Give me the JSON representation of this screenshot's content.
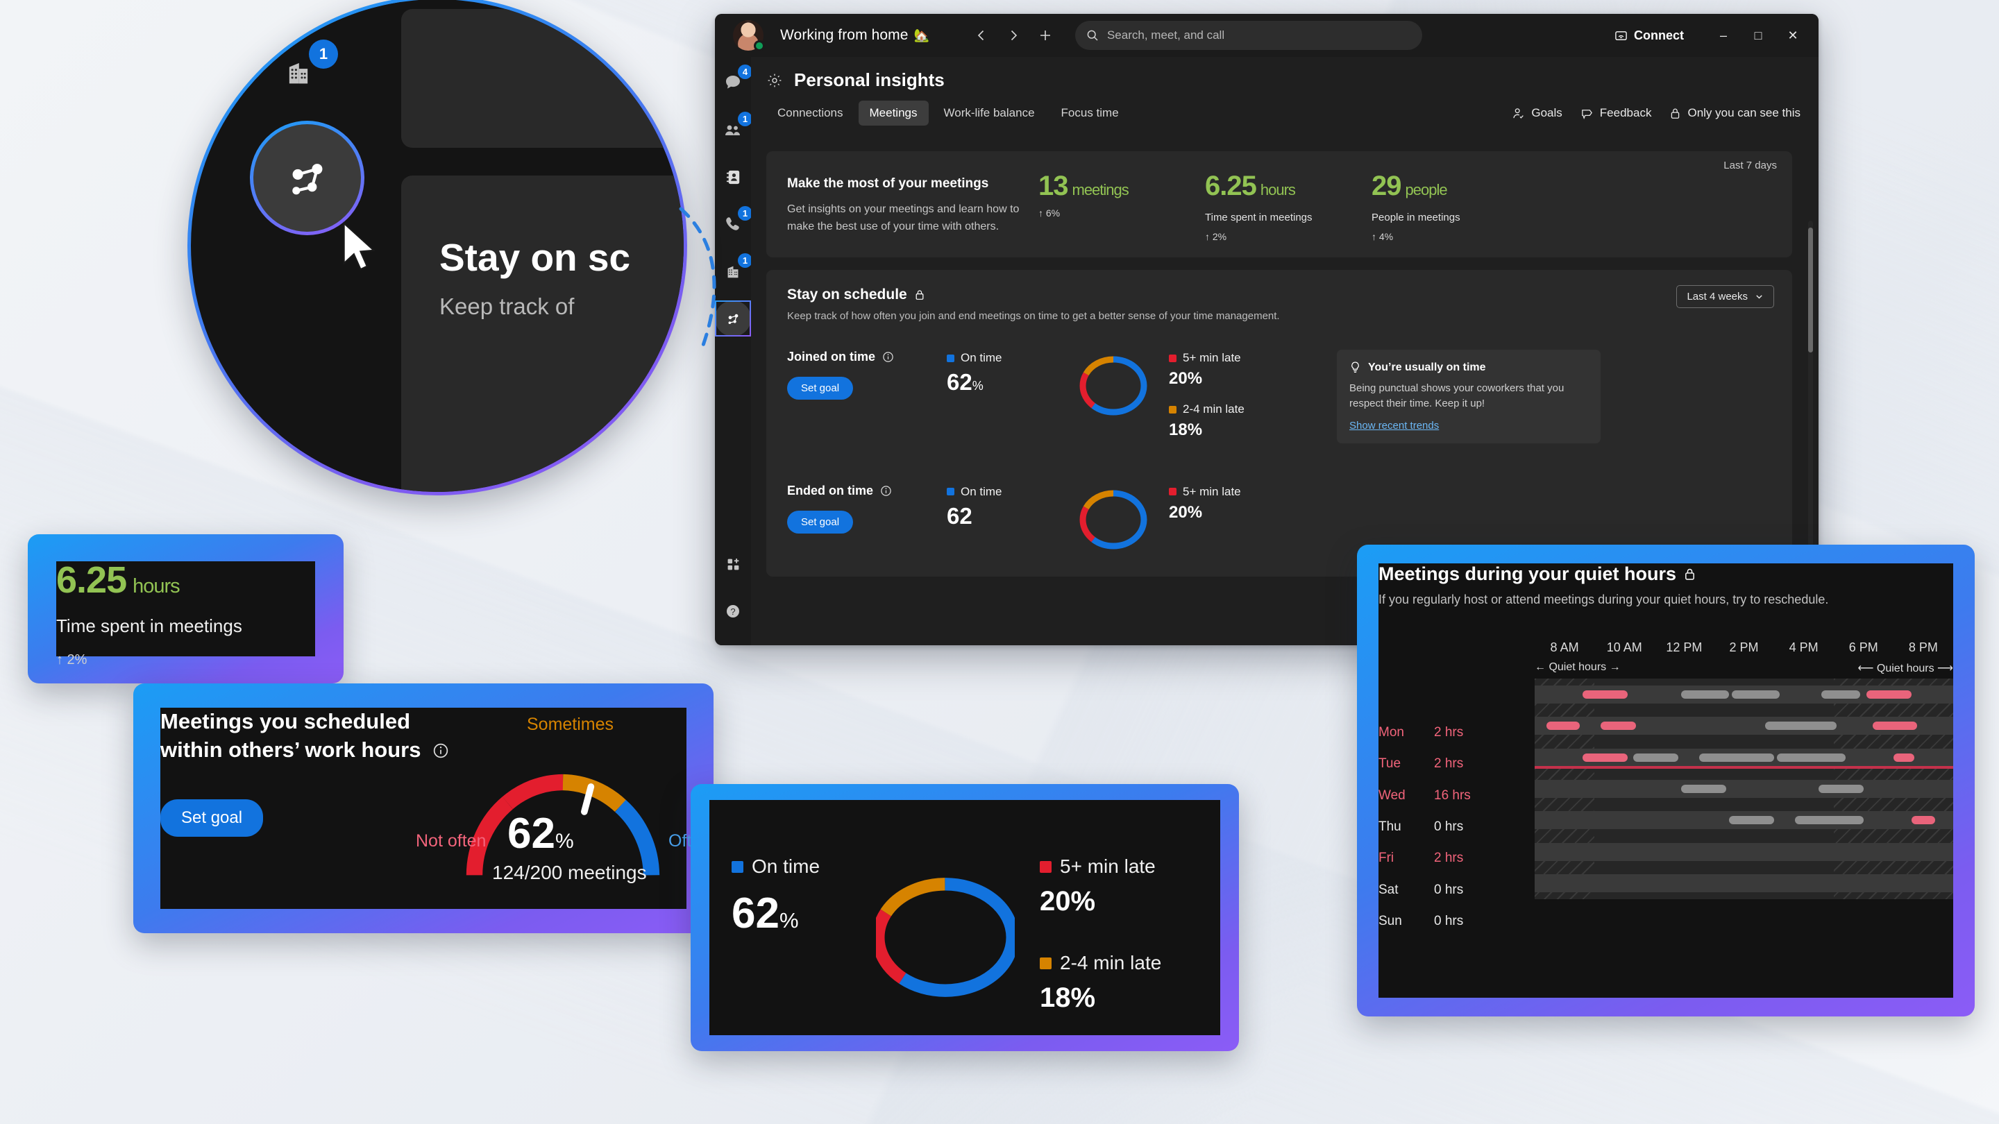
{
  "window": {
    "titlebar": {
      "status_text": "Working from home",
      "status_emoji": "🏡",
      "back_icon": "chevron-left-icon",
      "forward_icon": "chevron-right-icon",
      "new_icon": "plus-icon",
      "search_placeholder": "Search, meet, and call",
      "connect_label": "Connect",
      "minimize": "–",
      "maximize": "□",
      "close": "✕"
    },
    "rail": [
      {
        "name": "chat",
        "icon": "chat-icon",
        "badge": "4"
      },
      {
        "name": "teams",
        "icon": "people-icon",
        "badge": "1"
      },
      {
        "name": "contacts",
        "icon": "contact-card-icon",
        "badge": ""
      },
      {
        "name": "calls",
        "icon": "phone-icon",
        "badge": "1"
      },
      {
        "name": "calendar",
        "icon": "calendar-icon",
        "badge": "1"
      },
      {
        "name": "insights",
        "icon": "insights-icon",
        "badge": ""
      }
    ],
    "rail_bottom": [
      {
        "name": "apps",
        "icon": "apps-add-icon"
      },
      {
        "name": "help",
        "icon": "help-icon"
      }
    ],
    "page_title": "Personal insights",
    "page_title_icon": "gear-icon",
    "tabs": [
      {
        "label": "Connections",
        "active": false
      },
      {
        "label": "Meetings",
        "active": true
      },
      {
        "label": "Work-life balance",
        "active": false
      },
      {
        "label": "Focus time",
        "active": false
      }
    ],
    "head_actions": [
      {
        "label": "Goals",
        "icon": "person-goal-icon"
      },
      {
        "label": "Feedback",
        "icon": "megaphone-icon"
      },
      {
        "label": "Only you can see this",
        "icon": "lock-icon"
      }
    ],
    "hero": {
      "period": "Last 7 days",
      "heading": "Make the most of your meetings",
      "body": "Get insights on your meetings and learn how to make the best use of your time with others.",
      "kpis": [
        {
          "value": "13",
          "unit": "meetings",
          "label": "",
          "delta": "↑ 6%"
        },
        {
          "value": "6.25",
          "unit": "hours",
          "label": "Time spent in meetings",
          "delta": "↑ 2%"
        },
        {
          "value": "29",
          "unit": "people",
          "label": "People in meetings",
          "delta": "↑ 4%"
        }
      ]
    },
    "schedule": {
      "title": "Stay on schedule",
      "title_icon": "lock-icon",
      "subtitle": "Keep track of how often you join and end meetings on time to get a better sense of your time management.",
      "range_label": "Last 4 weeks",
      "range_icon": "chevron-down-icon",
      "joined": {
        "title": "Joined on time",
        "info_icon": "info-icon",
        "button": "Set goal",
        "ontime_label": "On time",
        "ontime_value": "62",
        "ontime_suffix": "%",
        "late5_label": "5+ min late",
        "late5_value": "20%",
        "late24_label": "2-4 min late",
        "late24_value": "18%"
      },
      "ended": {
        "title": "Ended on time",
        "info_icon": "info-icon",
        "ontime_label": "On time",
        "ontime_value": "62",
        "late5_label": "5+ min late",
        "late5_value": "20%"
      },
      "tip": {
        "icon": "lightbulb-icon",
        "heading": "You’re usually on time",
        "body": "Being punctual shows your coworkers that you respect their time. Keep it up!",
        "link": "Show recent trends"
      }
    }
  },
  "magnifier": {
    "panel_title": "Stay on sc",
    "panel_sub": "Keep track of",
    "active_icon": "insights-icon",
    "badge": "1",
    "cursor_icon": "mouse-pointer-icon"
  },
  "cards": {
    "hours": {
      "value": "6.25",
      "unit": "hours",
      "label": "Time spent in meetings",
      "delta": "↑ 2%"
    },
    "gauge": {
      "title": "Meetings you scheduled within others’ work hours",
      "info_icon": "info-icon",
      "button": "Set goal",
      "label_left": "Not often",
      "label_top": "Sometimes",
      "label_right": "Often",
      "value": "62",
      "value_suffix": "%",
      "sub": "124/200 meetings"
    },
    "donut": {
      "ontime_label": "On time",
      "ontime_value": "62",
      "ontime_suffix": "%",
      "late5_label": "5+ min late",
      "late5_value": "20%",
      "late24_label": "2-4 min late",
      "late24_value": "18%"
    },
    "quiet": {
      "title": "Meetings during your quiet hours",
      "title_icon": "lock-icon",
      "subtitle": "If you regularly host or attend meetings during your quiet hours, try to reschedule.",
      "quiet_left": "← Quiet hours →",
      "quiet_right": "⟵ Quiet hours ⟶"
    }
  },
  "colors": {
    "accent_blue": "#1273de",
    "green": "#92c353",
    "red": "#c4314b",
    "orange": "#d68300",
    "pink": "#e9647b",
    "gray_bar": "#8f8f8f"
  },
  "chart_data": [
    {
      "type": "pie",
      "name": "joined-on-time-donut",
      "title": "Joined on time",
      "labels": [
        "On time",
        "5+ min late",
        "2-4 min late"
      ],
      "values": [
        62,
        20,
        18
      ],
      "colors": [
        "#1273de",
        "#e31e2e",
        "#d68300"
      ],
      "legend": "sides"
    },
    {
      "type": "pie",
      "name": "ended-on-time-donut",
      "title": "Ended on time",
      "labels": [
        "On time",
        "5+ min late",
        "2-4 min late"
      ],
      "values": [
        62,
        20,
        18
      ],
      "colors": [
        "#1273de",
        "#e31e2e",
        "#d68300"
      ],
      "legend": "sides"
    },
    {
      "type": "pie",
      "name": "callout-donut",
      "title": "On time",
      "labels": [
        "On time",
        "5+ min late",
        "2-4 min late"
      ],
      "values": [
        62,
        20,
        18
      ],
      "colors": [
        "#1273de",
        "#e31e2e",
        "#d68300"
      ],
      "legend": "sides"
    },
    {
      "type": "bar",
      "name": "work-hours-gauge",
      "title": "Meetings you scheduled within others’ work hours",
      "categories": [
        "Not often",
        "Sometimes",
        "Often"
      ],
      "segment_colors": [
        "#e31e2e",
        "#d68300",
        "#1273de"
      ],
      "value": 62,
      "unit": "%",
      "detail": "124/200 meetings",
      "needle_position": 62,
      "ylim": [
        0,
        100
      ]
    },
    {
      "type": "heatmap",
      "name": "quiet-hours-timeline",
      "title": "Meetings during your quiet hours",
      "xlabel": "",
      "ylabel": "",
      "x_ticks": [
        "8 AM",
        "10 AM",
        "12 PM",
        "2 PM",
        "4 PM",
        "6 PM",
        "8 PM"
      ],
      "x_range_hours": [
        7,
        21
      ],
      "quiet_left_label": "← Quiet hours →",
      "quiet_right_label": "⟵ Quiet hours ⟶",
      "quiet_before_hour": 9,
      "quiet_after_hour": 17,
      "rows": [
        {
          "day": "Mon",
          "hours": "2 hrs",
          "over": true,
          "blocks": [
            {
              "start": 8.6,
              "end": 10.1,
              "kind": "quiet"
            },
            {
              "start": 11.9,
              "end": 13.5,
              "kind": "normal"
            },
            {
              "start": 13.6,
              "end": 15.2,
              "kind": "normal"
            },
            {
              "start": 16.6,
              "end": 17.9,
              "kind": "normal"
            },
            {
              "start": 18.1,
              "end": 19.6,
              "kind": "quiet"
            }
          ]
        },
        {
          "day": "Tue",
          "hours": "2 hrs",
          "over": true,
          "blocks": [
            {
              "start": 7.4,
              "end": 8.5,
              "kind": "quiet"
            },
            {
              "start": 9.2,
              "end": 10.4,
              "kind": "quiet"
            },
            {
              "start": 14.7,
              "end": 17.1,
              "kind": "normal"
            },
            {
              "start": 18.3,
              "end": 19.8,
              "kind": "quiet"
            }
          ]
        },
        {
          "day": "Wed",
          "hours": "16 hrs",
          "over": true,
          "goal_line": true,
          "blocks": [
            {
              "start": 8.6,
              "end": 10.1,
              "kind": "quiet"
            },
            {
              "start": 10.3,
              "end": 11.8,
              "kind": "normal"
            },
            {
              "start": 12.5,
              "end": 15.0,
              "kind": "normal"
            },
            {
              "start": 15.1,
              "end": 17.4,
              "kind": "normal"
            },
            {
              "start": 19.0,
              "end": 19.7,
              "kind": "quiet"
            }
          ]
        },
        {
          "day": "Thu",
          "hours": "0 hrs",
          "over": false,
          "blocks": [
            {
              "start": 11.9,
              "end": 13.4,
              "kind": "normal"
            },
            {
              "start": 16.5,
              "end": 18.0,
              "kind": "normal"
            }
          ]
        },
        {
          "day": "Fri",
          "hours": "2 hrs",
          "over": true,
          "blocks": [
            {
              "start": 13.5,
              "end": 15.0,
              "kind": "normal"
            },
            {
              "start": 15.7,
              "end": 18.0,
              "kind": "normal"
            },
            {
              "start": 19.6,
              "end": 20.4,
              "kind": "quiet"
            }
          ]
        },
        {
          "day": "Sat",
          "hours": "0 hrs",
          "over": false,
          "blocks": []
        },
        {
          "day": "Sun",
          "hours": "0 hrs",
          "over": false,
          "blocks": []
        }
      ]
    }
  ]
}
